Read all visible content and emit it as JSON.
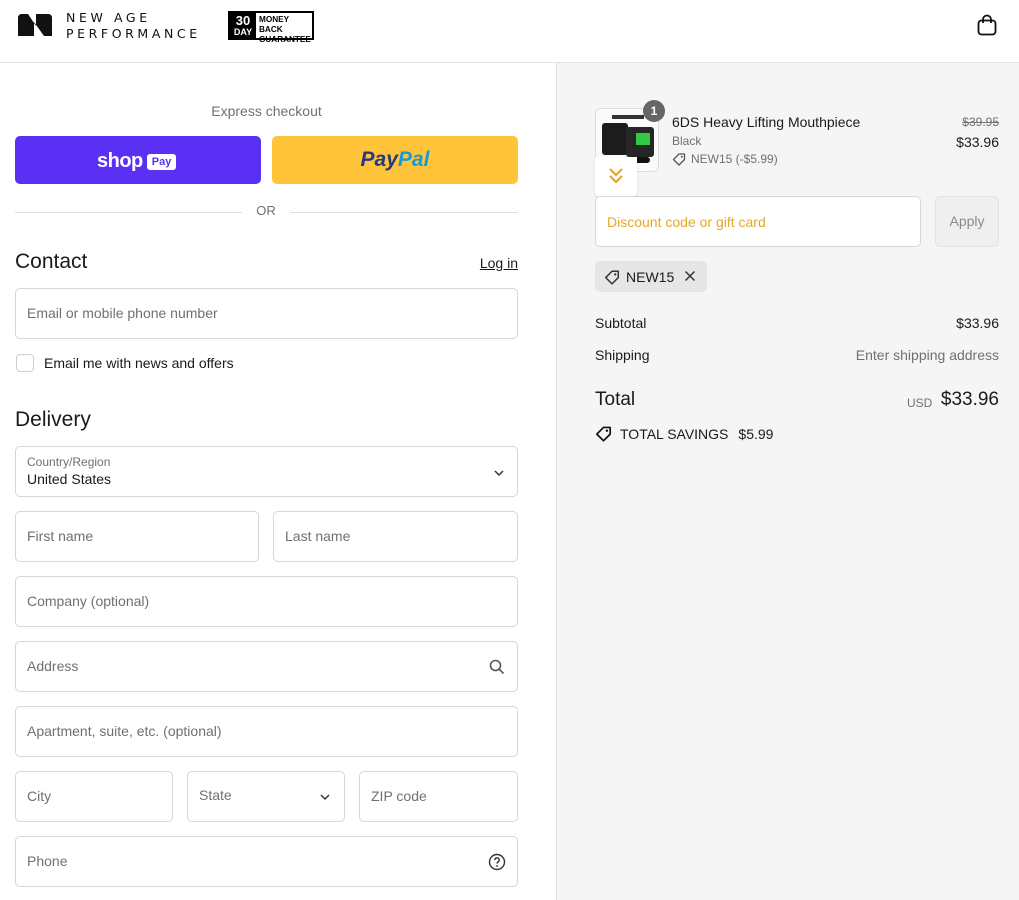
{
  "header": {
    "brand_line1": "NEW AGE",
    "brand_line2": "PERFORMANCE",
    "badge_number": "30",
    "badge_day": "DAY",
    "badge_line1": "MONEY BACK",
    "badge_line2": "GUARANTEE"
  },
  "express": {
    "title": "Express checkout",
    "shop_label": "shop",
    "shop_pay_label": "Pay",
    "paypal_part1": "Pay",
    "paypal_part2": "Pal",
    "or_label": "OR"
  },
  "contact": {
    "heading": "Contact",
    "login_label": "Log in",
    "email_placeholder": "Email or mobile phone number",
    "newsletter_label": "Email me with news and offers",
    "newsletter_checked": false
  },
  "delivery": {
    "heading": "Delivery",
    "country_label": "Country/Region",
    "country_value": "United States",
    "first_name_placeholder": "First name",
    "last_name_placeholder": "Last name",
    "company_placeholder": "Company (optional)",
    "address_placeholder": "Address",
    "apartment_placeholder": "Apartment, suite, etc. (optional)",
    "city_placeholder": "City",
    "state_placeholder": "State",
    "zip_placeholder": "ZIP code",
    "phone_placeholder": "Phone"
  },
  "summary": {
    "product": {
      "quantity": "1",
      "name": "6DS Heavy Lifting Mouthpiece",
      "variant": "Black",
      "discount_note": "NEW15 (-$5.99)",
      "price_original": "$39.95",
      "price_final": "$33.96"
    },
    "discount_placeholder": "Discount code or gift card",
    "apply_label": "Apply",
    "applied_code": "NEW15",
    "subtotal_label": "Subtotal",
    "subtotal_value": "$33.96",
    "shipping_label": "Shipping",
    "shipping_value": "Enter shipping address",
    "total_label": "Total",
    "total_currency": "USD",
    "total_value": "$33.96",
    "savings_label": "TOTAL SAVINGS",
    "savings_value": "$5.99"
  },
  "colors": {
    "shop_pay": "#5a31f4",
    "paypal": "#ffc439",
    "summary_bg": "#f5f5f5",
    "discount_placeholder": "#e0a92a"
  }
}
